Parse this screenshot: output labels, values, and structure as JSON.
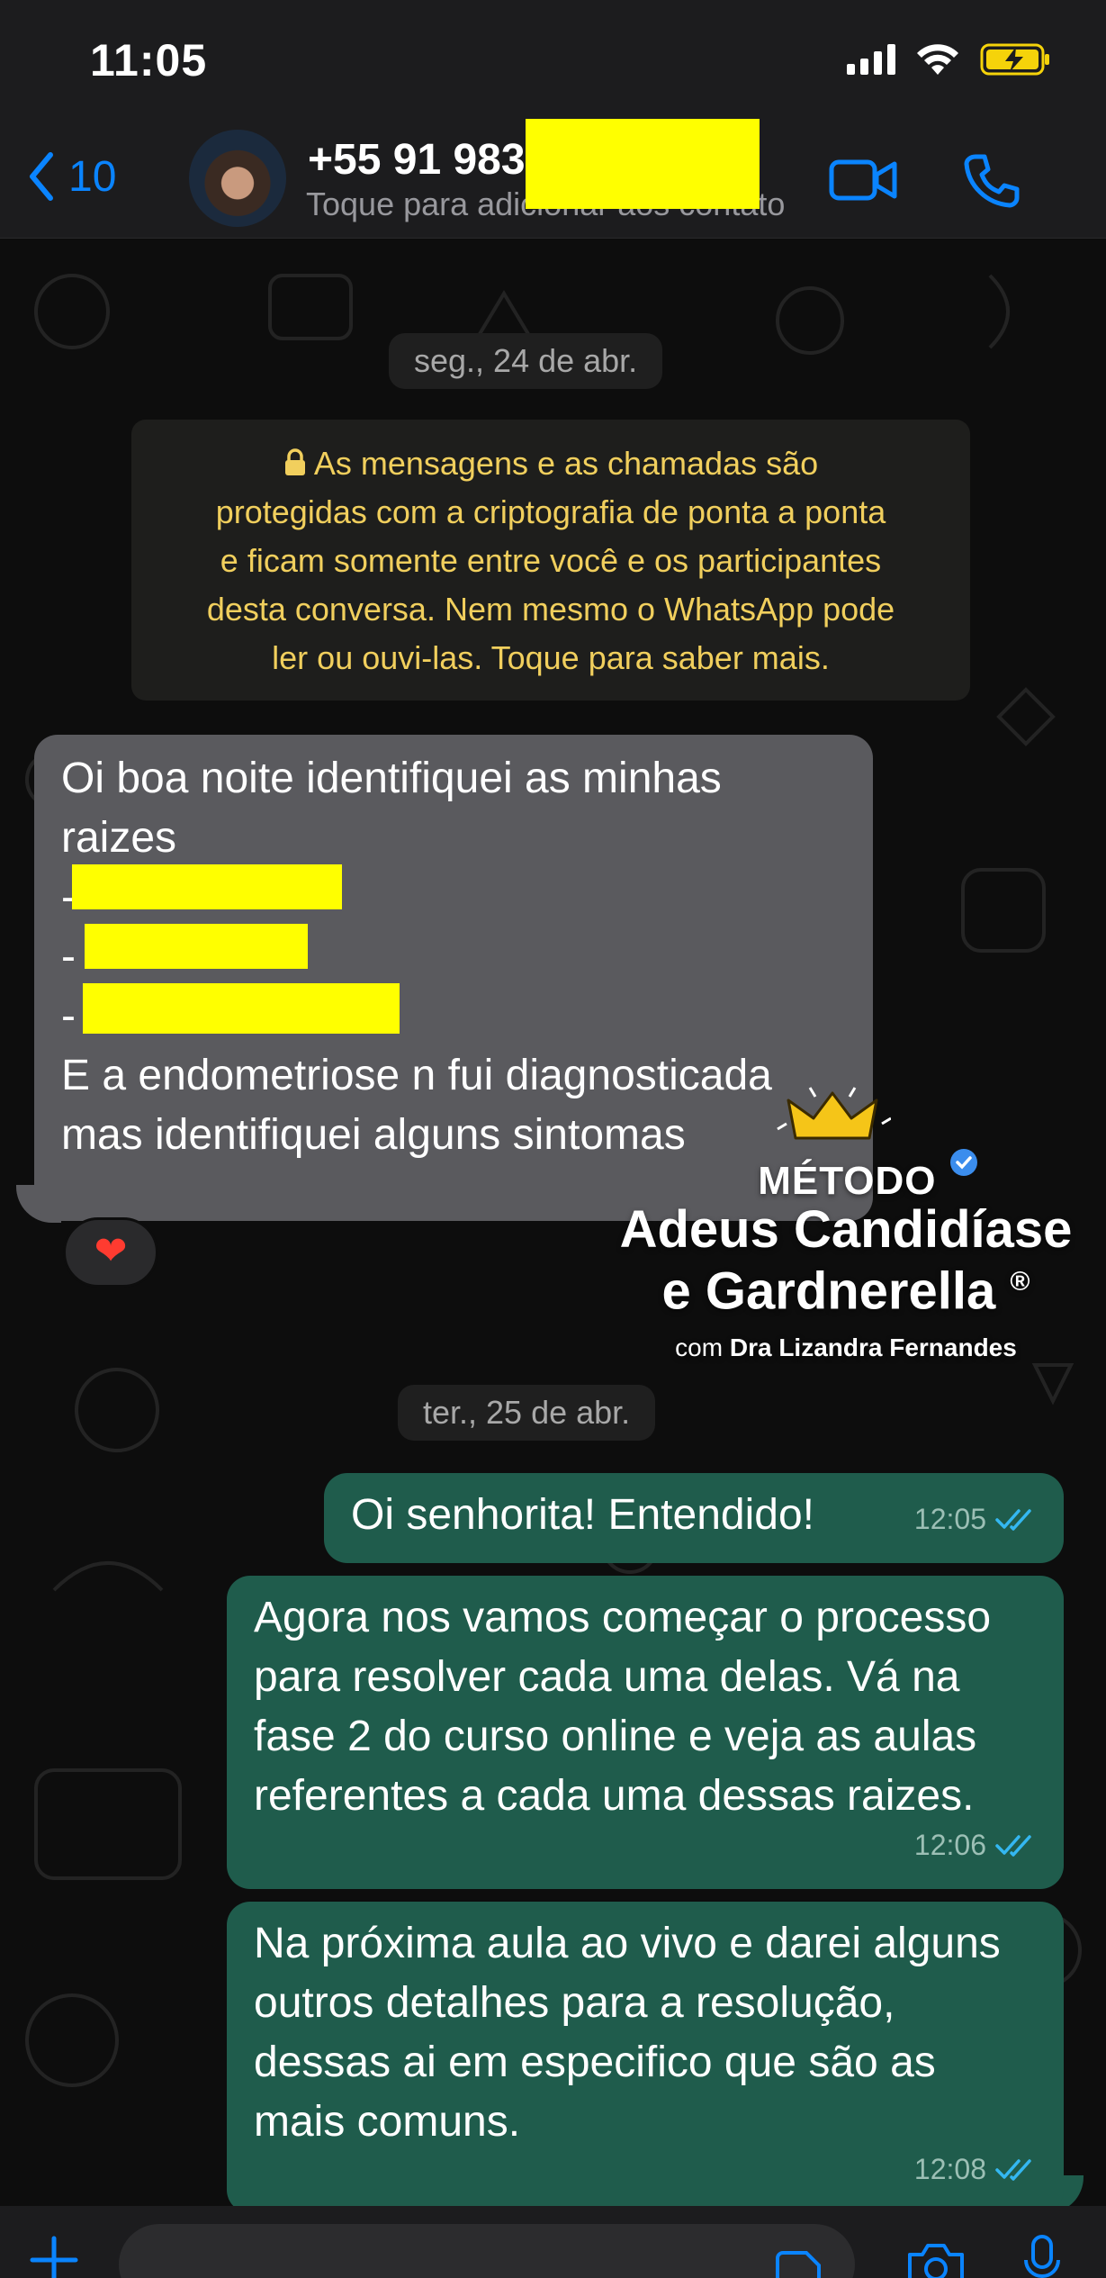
{
  "status": {
    "time": "11:05"
  },
  "header": {
    "back_count": "10",
    "contact_name": "+55 91 983",
    "contact_subtitle": "Toque para adicionar aos contato"
  },
  "chat": {
    "date_1": "seg., 24 de abr.",
    "encryption_notice": [
      "As mensagens e as chamadas são",
      "protegidas com a criptografia de ponta a ponta",
      "e ficam somente entre você e os participantes",
      "desta conversa. Nem mesmo o WhatsApp pode",
      "ler ou ouvi-las. Toque para saber mais."
    ],
    "incoming": {
      "line_1": "Oi boa noite identifiquei as minhas",
      "line_2": "raizes",
      "line_3": "-",
      "line_4": "-",
      "line_5": "-",
      "line_6": "E a endometriose n fui diagnosticada",
      "line_7": "mas identifiquei alguns sintomas",
      "reaction": "❤"
    },
    "date_2": "ter., 25 de abr.",
    "outgoing": [
      {
        "text": "Oi senhorita! Entendido!",
        "time": "12:05"
      },
      {
        "lines": [
          "Agora nos vamos começar o processo",
          "para resolver cada uma delas. Vá na",
          "fase 2 do curso online e veja as aulas",
          "referentes a cada uma dessas raizes."
        ],
        "time": "12:06"
      },
      {
        "lines": [
          "Na próxima aula ao vivo e darei alguns",
          "outros detalhes para a resolução,",
          "dessas ai em especifico que são as",
          "mais comuns."
        ],
        "time": "12:08"
      }
    ]
  },
  "watermark": {
    "top": "MÉTODO",
    "main_1": "Adeus Candidíase",
    "main_2": "e Gardnerella",
    "registered": "®",
    "sub_prefix": "com",
    "sub_name": "Dra Lizandra Fernandes"
  },
  "colors": {
    "accent": "#0a84ff",
    "outgoing_bubble": "#1f5c4c",
    "incoming_bubble": "#5a5a5e",
    "encryption_text": "#f1cf5d",
    "redaction": "#ffff00",
    "read_receipt": "#34b7f1"
  }
}
